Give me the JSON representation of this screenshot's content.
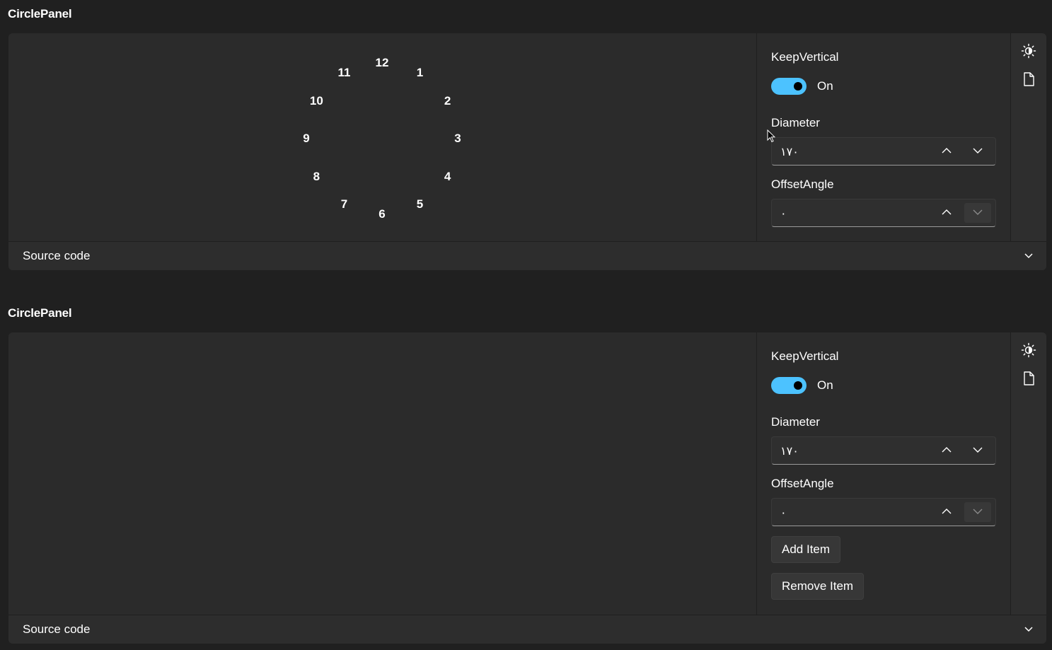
{
  "sections": [
    {
      "title": "CirclePanel",
      "clock_items": [
        "12",
        "1",
        "2",
        "3",
        "4",
        "5",
        "6",
        "7",
        "8",
        "9",
        "10",
        "11"
      ],
      "keep_vertical_label": "KeepVertical",
      "toggle_state": "On",
      "diameter_label": "Diameter",
      "diameter_value": "۱۷۰",
      "offset_angle_label": "OffsetAngle",
      "offset_angle_value": "۰",
      "source_code_label": "Source code"
    },
    {
      "title": "CirclePanel",
      "keep_vertical_label": "KeepVertical",
      "toggle_state": "On",
      "diameter_label": "Diameter",
      "diameter_value": "۱۷۰",
      "offset_angle_label": "OffsetAngle",
      "offset_angle_value": "۰",
      "add_item_label": "Add Item",
      "remove_item_label": "Remove Item",
      "source_code_label": "Source code"
    }
  ],
  "colors": {
    "accent": "#4cc2ff",
    "background": "#202020",
    "card": "#2b2b2b"
  },
  "icons": {
    "theme": "brightness-icon",
    "file": "document-icon",
    "expand": "chevron-down-icon"
  }
}
